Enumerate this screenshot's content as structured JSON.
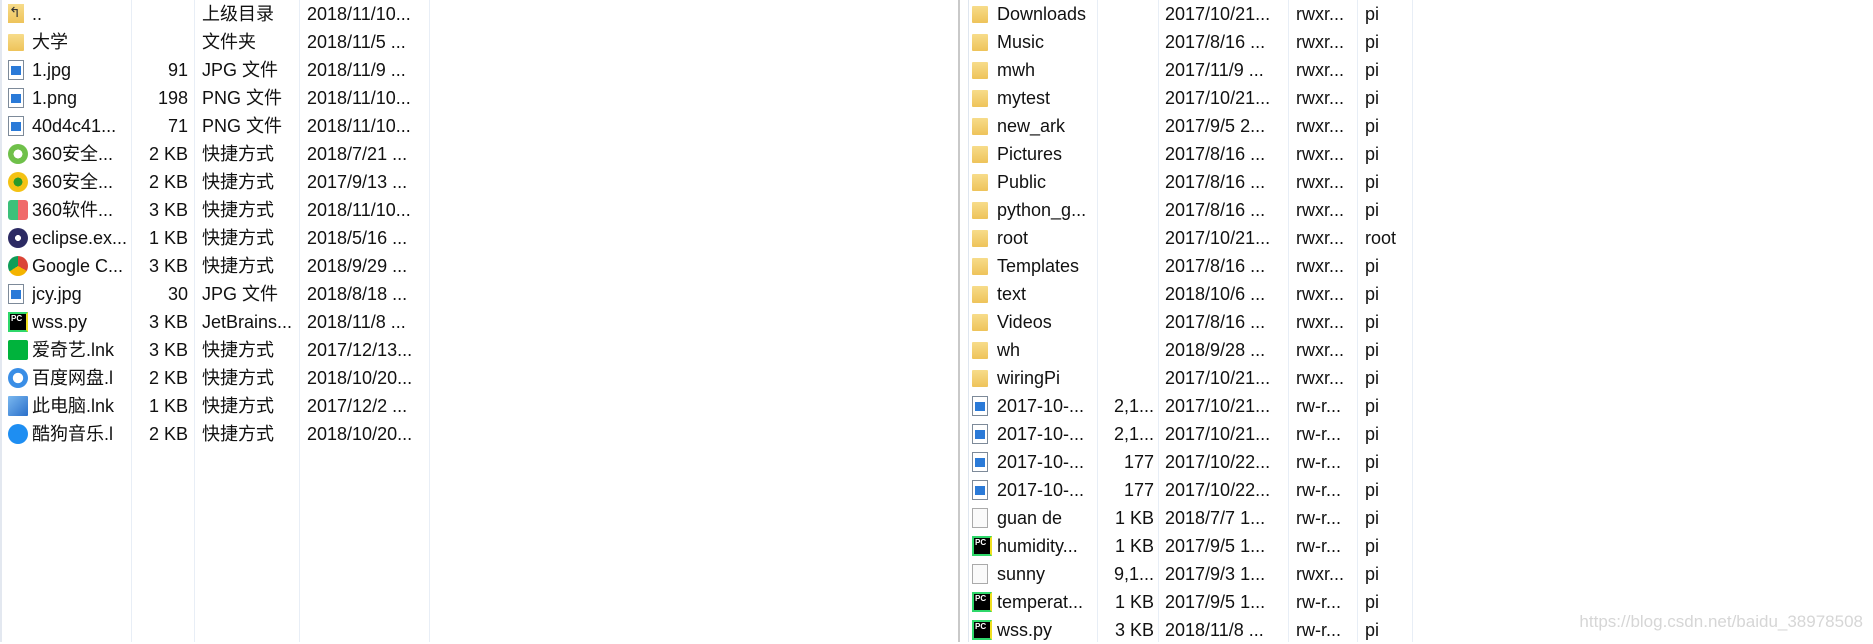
{
  "local_panel": {
    "rows": [
      {
        "icon": "parent-folder-icon",
        "name": "..",
        "size": "",
        "type": "上级目录",
        "modified": "2018/11/10..."
      },
      {
        "icon": "folder-icon",
        "name": "大学",
        "size": "",
        "type": "文件夹",
        "modified": "2018/11/5  ..."
      },
      {
        "icon": "image-file-icon",
        "name": "1.jpg",
        "size": "91",
        "type": "JPG 文件",
        "modified": "2018/11/9  ..."
      },
      {
        "icon": "image-file-icon",
        "name": "1.png",
        "size": "198",
        "type": "PNG 文件",
        "modified": "2018/11/10..."
      },
      {
        "icon": "image-file-icon",
        "name": "40d4c41...",
        "size": "71",
        "type": "PNG 文件",
        "modified": "2018/11/10..."
      },
      {
        "icon": "360-safe-icon",
        "name": "360安全...",
        "size": "2 KB",
        "type": "快捷方式",
        "modified": "2018/7/21  ..."
      },
      {
        "icon": "360-guard-icon",
        "name": "360安全...",
        "size": "2 KB",
        "type": "快捷方式",
        "modified": "2017/9/13  ..."
      },
      {
        "icon": "360-software-icon",
        "name": "360软件...",
        "size": "3 KB",
        "type": "快捷方式",
        "modified": "2018/11/10..."
      },
      {
        "icon": "eclipse-icon",
        "name": "eclipse.ex...",
        "size": "1 KB",
        "type": "快捷方式",
        "modified": "2018/5/16  ..."
      },
      {
        "icon": "chrome-icon",
        "name": "Google C...",
        "size": "3 KB",
        "type": "快捷方式",
        "modified": "2018/9/29  ..."
      },
      {
        "icon": "image-file-icon",
        "name": "jcy.jpg",
        "size": "30",
        "type": "JPG 文件",
        "modified": "2018/8/18  ..."
      },
      {
        "icon": "pycharm-icon",
        "name": "wss.py",
        "size": "3 KB",
        "type": "JetBrains...",
        "modified": "2018/11/8  ..."
      },
      {
        "icon": "iqiyi-icon",
        "name": "爱奇艺.lnk",
        "size": "3 KB",
        "type": "快捷方式",
        "modified": "2017/12/13..."
      },
      {
        "icon": "baidu-netdisk-icon",
        "name": "百度网盘.l",
        "size": "2 KB",
        "type": "快捷方式",
        "modified": "2018/10/20..."
      },
      {
        "icon": "this-pc-icon",
        "name": "此电脑.lnk",
        "size": "1 KB",
        "type": "快捷方式",
        "modified": "2017/12/2  ..."
      },
      {
        "icon": "kugou-icon",
        "name": "酷狗音乐.l",
        "size": "2 KB",
        "type": "快捷方式",
        "modified": "2018/10/20..."
      }
    ]
  },
  "remote_panel": {
    "rows": [
      {
        "icon": "folder-icon",
        "name": "Downloads",
        "size": "",
        "modified": "2017/10/21...",
        "perms": "rwxr...",
        "owner": "pi"
      },
      {
        "icon": "folder-icon",
        "name": "Music",
        "size": "",
        "modified": "2017/8/16 ...",
        "perms": "rwxr...",
        "owner": "pi"
      },
      {
        "icon": "folder-icon",
        "name": "mwh",
        "size": "",
        "modified": "2017/11/9 ...",
        "perms": "rwxr...",
        "owner": "pi"
      },
      {
        "icon": "folder-icon",
        "name": "mytest",
        "size": "",
        "modified": "2017/10/21...",
        "perms": "rwxr...",
        "owner": "pi"
      },
      {
        "icon": "folder-icon",
        "name": "new_ark",
        "size": "",
        "modified": "2017/9/5 2...",
        "perms": "rwxr...",
        "owner": "pi"
      },
      {
        "icon": "folder-icon",
        "name": "Pictures",
        "size": "",
        "modified": "2017/8/16 ...",
        "perms": "rwxr...",
        "owner": "pi"
      },
      {
        "icon": "folder-icon",
        "name": "Public",
        "size": "",
        "modified": "2017/8/16 ...",
        "perms": "rwxr...",
        "owner": "pi"
      },
      {
        "icon": "folder-icon",
        "name": "python_g...",
        "size": "",
        "modified": "2017/8/16 ...",
        "perms": "rwxr...",
        "owner": "pi"
      },
      {
        "icon": "folder-icon",
        "name": "root",
        "size": "",
        "modified": "2017/10/21...",
        "perms": "rwxr...",
        "owner": "root"
      },
      {
        "icon": "folder-icon",
        "name": "Templates",
        "size": "",
        "modified": "2017/8/16 ...",
        "perms": "rwxr...",
        "owner": "pi"
      },
      {
        "icon": "folder-icon",
        "name": "text",
        "size": "",
        "modified": "2018/10/6 ...",
        "perms": "rwxr...",
        "owner": "pi"
      },
      {
        "icon": "folder-icon",
        "name": "Videos",
        "size": "",
        "modified": "2017/8/16 ...",
        "perms": "rwxr...",
        "owner": "pi"
      },
      {
        "icon": "folder-icon",
        "name": "wh",
        "size": "",
        "modified": "2018/9/28 ...",
        "perms": "rwxr...",
        "owner": "pi"
      },
      {
        "icon": "folder-icon",
        "name": "wiringPi",
        "size": "",
        "modified": "2017/10/21...",
        "perms": "rwxr...",
        "owner": "pi"
      },
      {
        "icon": "image-file-icon",
        "name": "2017-10-...",
        "size": "2,1...",
        "modified": "2017/10/21...",
        "perms": "rw-r...",
        "owner": "pi"
      },
      {
        "icon": "image-file-icon",
        "name": "2017-10-...",
        "size": "2,1...",
        "modified": "2017/10/21...",
        "perms": "rw-r...",
        "owner": "pi"
      },
      {
        "icon": "image-file-icon",
        "name": "2017-10-...",
        "size": "177",
        "modified": "2017/10/22...",
        "perms": "rw-r...",
        "owner": "pi"
      },
      {
        "icon": "image-file-icon",
        "name": "2017-10-...",
        "size": "177",
        "modified": "2017/10/22...",
        "perms": "rw-r...",
        "owner": "pi"
      },
      {
        "icon": "file-icon",
        "name": "guan  de",
        "size": "1 KB",
        "modified": "2018/7/7 1...",
        "perms": "rw-r...",
        "owner": "pi"
      },
      {
        "icon": "pycharm-icon",
        "name": "humidity...",
        "size": "1 KB",
        "modified": "2017/9/5 1...",
        "perms": "rw-r...",
        "owner": "pi"
      },
      {
        "icon": "file-icon",
        "name": "sunny",
        "size": "9,1...",
        "modified": "2017/9/3 1...",
        "perms": "rwxr...",
        "owner": "pi"
      },
      {
        "icon": "pycharm-icon",
        "name": "temperat...",
        "size": "1 KB",
        "modified": "2017/9/5 1...",
        "perms": "rw-r...",
        "owner": "pi"
      },
      {
        "icon": "pycharm-icon",
        "name": "wss.py",
        "size": "3 KB",
        "modified": "2018/11/8 ...",
        "perms": "rw-r...",
        "owner": "pi"
      }
    ]
  },
  "watermark": "https://blog.csdn.net/baidu_38978508"
}
